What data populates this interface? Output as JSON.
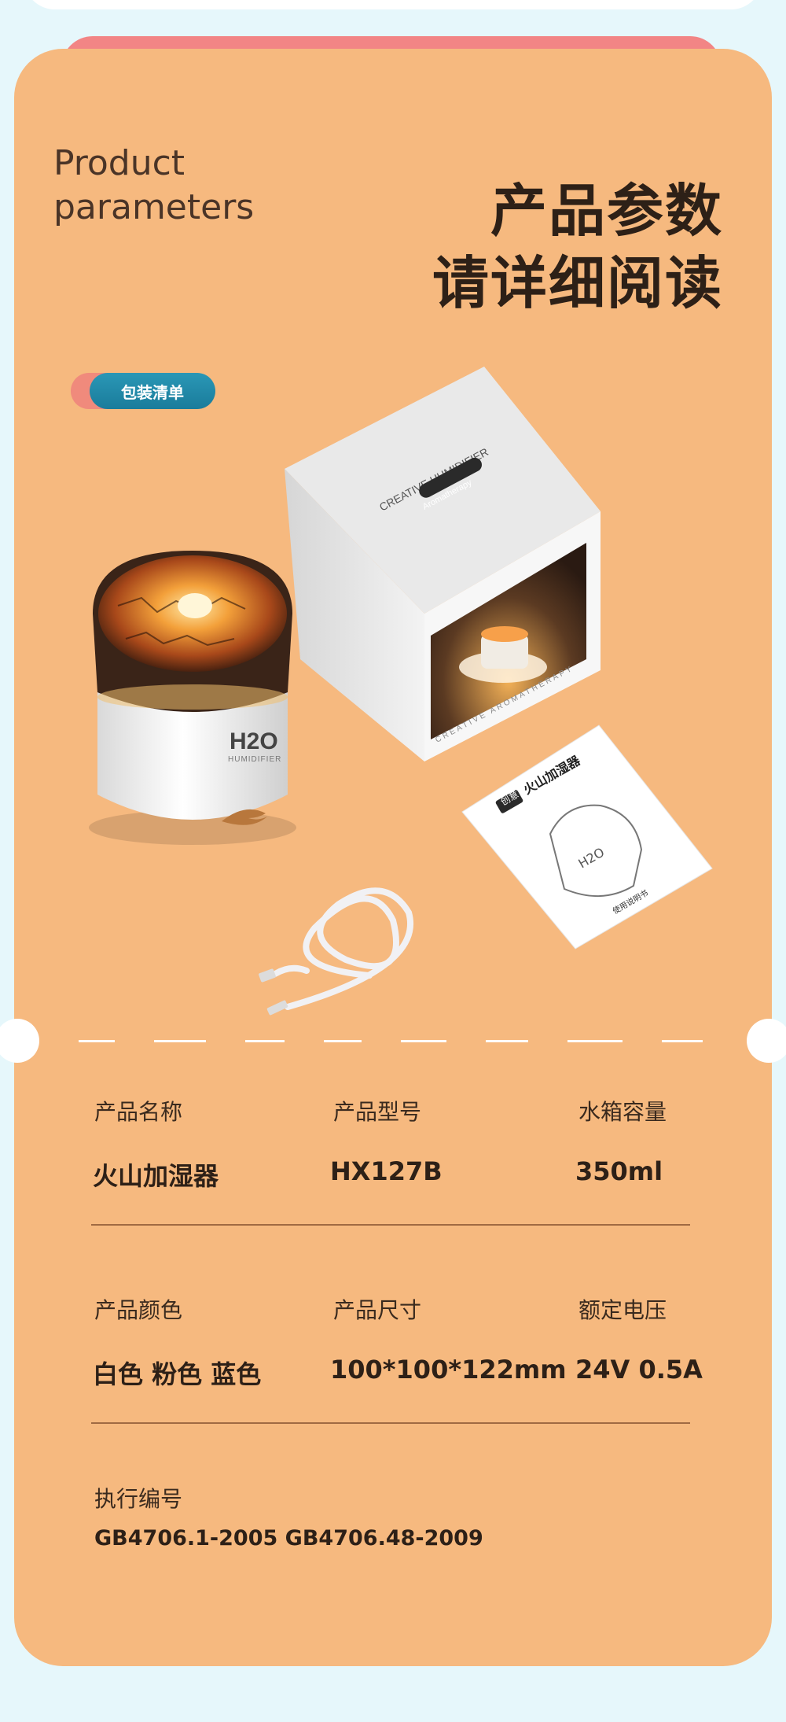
{
  "header": {
    "title_en": "Product parameters",
    "title_cn_line1": "产品参数",
    "title_cn_line2": "请详细阅读"
  },
  "package_badge": {
    "label": "包装清单"
  },
  "illustration": {
    "box_text_top": "CREATIVE HUMIDIFIER",
    "box_badge": "Aromatherapy",
    "box_text_bottom": "CREATIVE AROMATHERAPY",
    "device_logo": "H2O",
    "device_sub": "HUMIDIFIER",
    "manual_tag": "创意",
    "manual_title": "火山加湿器",
    "manual_logo": "H2O",
    "manual_footer": "使用说明书"
  },
  "specs": {
    "row1": [
      {
        "label": "产品名称",
        "value": "火山加湿器"
      },
      {
        "label": "产品型号",
        "value": "HX127B"
      },
      {
        "label": "水箱容量",
        "value": "350ml"
      }
    ],
    "row2": [
      {
        "label": "产品颜色",
        "value": "白色 粉色 蓝色"
      },
      {
        "label": "产品尺寸",
        "value": "100*100*122mm"
      },
      {
        "label": "额定电压",
        "value": "24V 0.5A"
      }
    ],
    "standard": {
      "label": "执行编号",
      "value": "GB4706.1-2005 GB4706.48-2009"
    }
  },
  "colors": {
    "card": "#f6b97f",
    "background": "#e6f7fb",
    "pink_tab": "#f28585",
    "badge_blue": "#1a7c9b"
  }
}
